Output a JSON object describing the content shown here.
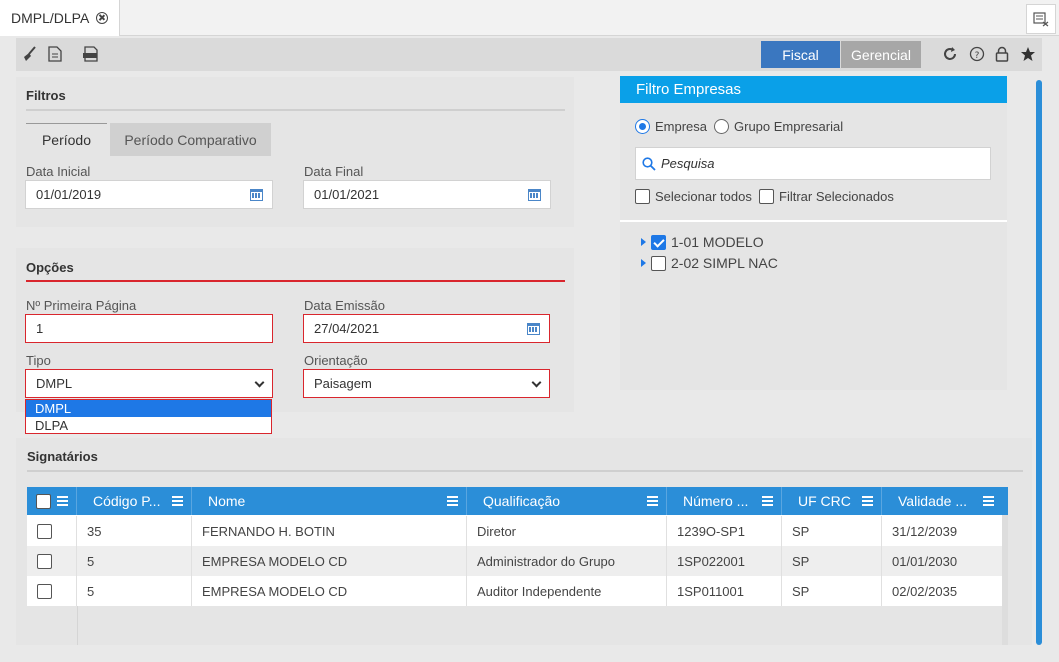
{
  "tab": {
    "label": "DMPL/DLPA"
  },
  "toolbar": {
    "fiscal_label": "Fiscal",
    "gerencial_label": "Gerencial"
  },
  "filtros": {
    "title": "Filtros",
    "tabs": [
      "Período",
      "Período Comparativo"
    ],
    "data_inicial_label": "Data Inicial",
    "data_inicial_value": "01/01/2019",
    "data_final_label": "Data Final",
    "data_final_value": "01/01/2021"
  },
  "opcoes": {
    "title": "Opções",
    "primeira_pagina_label": "Nº Primeira Página",
    "primeira_pagina_value": "1",
    "data_emissao_label": "Data Emissão",
    "data_emissao_value": "27/04/2021",
    "tipo_label": "Tipo",
    "tipo_value": "DMPL",
    "tipo_options": [
      "DMPL",
      "DLPA"
    ],
    "orientacao_label": "Orientação",
    "orientacao_value": "Paisagem"
  },
  "filtro_empresas": {
    "title": "Filtro Empresas",
    "radio_empresa": "Empresa",
    "radio_grupo": "Grupo Empresarial",
    "search_placeholder": "Pesquisa",
    "selecionar_todos": "Selecionar todos",
    "filtrar_selecionados": "Filtrar Selecionados",
    "items": [
      {
        "label": "1-01 MODELO",
        "checked": true
      },
      {
        "label": "2-02 SIMPL NAC",
        "checked": false
      }
    ]
  },
  "signatarios": {
    "title": "Signatários",
    "columns": [
      "Código P...",
      "Nome",
      "Qualificação",
      "Número ...",
      "UF CRC",
      "Validade ..."
    ],
    "rows": [
      [
        "35",
        "FERNANDO H. BOTIN",
        "Diretor",
        "1239O-SP1",
        "SP",
        "31/12/2039"
      ],
      [
        "5",
        "EMPRESA MODELO CD",
        "Administrador do Grupo",
        "1SP022001",
        "SP",
        "01/01/2030"
      ],
      [
        "5",
        "EMPRESA MODELO CD",
        "Auditor Independente",
        "1SP011001",
        "SP",
        "02/02/2035"
      ]
    ]
  },
  "colors": {
    "accent": "#3a77c0",
    "header_blue": "#0aa0e8",
    "grid_blue": "#2b8ed8",
    "error_red": "#d9262d"
  }
}
